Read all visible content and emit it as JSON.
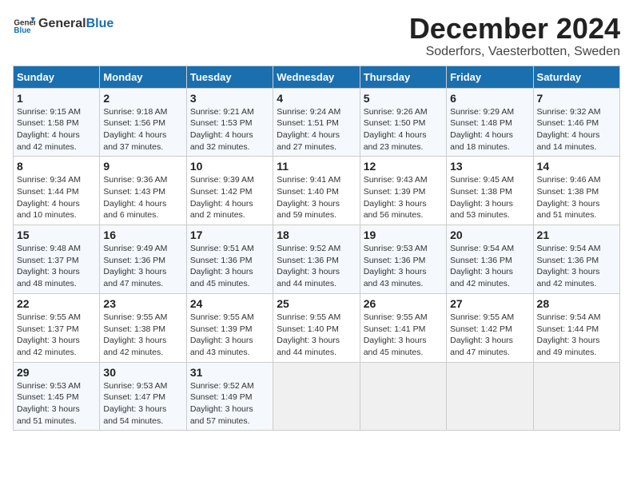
{
  "header": {
    "logo_general": "General",
    "logo_blue": "Blue",
    "title": "December 2024",
    "subtitle": "Soderfors, Vaesterbotten, Sweden"
  },
  "calendar": {
    "weekdays": [
      "Sunday",
      "Monday",
      "Tuesday",
      "Wednesday",
      "Thursday",
      "Friday",
      "Saturday"
    ],
    "weeks": [
      [
        {
          "day": "1",
          "detail": "Sunrise: 9:15 AM\nSunset: 1:58 PM\nDaylight: 4 hours\nand 42 minutes."
        },
        {
          "day": "2",
          "detail": "Sunrise: 9:18 AM\nSunset: 1:56 PM\nDaylight: 4 hours\nand 37 minutes."
        },
        {
          "day": "3",
          "detail": "Sunrise: 9:21 AM\nSunset: 1:53 PM\nDaylight: 4 hours\nand 32 minutes."
        },
        {
          "day": "4",
          "detail": "Sunrise: 9:24 AM\nSunset: 1:51 PM\nDaylight: 4 hours\nand 27 minutes."
        },
        {
          "day": "5",
          "detail": "Sunrise: 9:26 AM\nSunset: 1:50 PM\nDaylight: 4 hours\nand 23 minutes."
        },
        {
          "day": "6",
          "detail": "Sunrise: 9:29 AM\nSunset: 1:48 PM\nDaylight: 4 hours\nand 18 minutes."
        },
        {
          "day": "7",
          "detail": "Sunrise: 9:32 AM\nSunset: 1:46 PM\nDaylight: 4 hours\nand 14 minutes."
        }
      ],
      [
        {
          "day": "8",
          "detail": "Sunrise: 9:34 AM\nSunset: 1:44 PM\nDaylight: 4 hours\nand 10 minutes."
        },
        {
          "day": "9",
          "detail": "Sunrise: 9:36 AM\nSunset: 1:43 PM\nDaylight: 4 hours\nand 6 minutes."
        },
        {
          "day": "10",
          "detail": "Sunrise: 9:39 AM\nSunset: 1:42 PM\nDaylight: 4 hours\nand 2 minutes."
        },
        {
          "day": "11",
          "detail": "Sunrise: 9:41 AM\nSunset: 1:40 PM\nDaylight: 3 hours\nand 59 minutes."
        },
        {
          "day": "12",
          "detail": "Sunrise: 9:43 AM\nSunset: 1:39 PM\nDaylight: 3 hours\nand 56 minutes."
        },
        {
          "day": "13",
          "detail": "Sunrise: 9:45 AM\nSunset: 1:38 PM\nDaylight: 3 hours\nand 53 minutes."
        },
        {
          "day": "14",
          "detail": "Sunrise: 9:46 AM\nSunset: 1:38 PM\nDaylight: 3 hours\nand 51 minutes."
        }
      ],
      [
        {
          "day": "15",
          "detail": "Sunrise: 9:48 AM\nSunset: 1:37 PM\nDaylight: 3 hours\nand 48 minutes."
        },
        {
          "day": "16",
          "detail": "Sunrise: 9:49 AM\nSunset: 1:36 PM\nDaylight: 3 hours\nand 47 minutes."
        },
        {
          "day": "17",
          "detail": "Sunrise: 9:51 AM\nSunset: 1:36 PM\nDaylight: 3 hours\nand 45 minutes."
        },
        {
          "day": "18",
          "detail": "Sunrise: 9:52 AM\nSunset: 1:36 PM\nDaylight: 3 hours\nand 44 minutes."
        },
        {
          "day": "19",
          "detail": "Sunrise: 9:53 AM\nSunset: 1:36 PM\nDaylight: 3 hours\nand 43 minutes."
        },
        {
          "day": "20",
          "detail": "Sunrise: 9:54 AM\nSunset: 1:36 PM\nDaylight: 3 hours\nand 42 minutes."
        },
        {
          "day": "21",
          "detail": "Sunrise: 9:54 AM\nSunset: 1:36 PM\nDaylight: 3 hours\nand 42 minutes."
        }
      ],
      [
        {
          "day": "22",
          "detail": "Sunrise: 9:55 AM\nSunset: 1:37 PM\nDaylight: 3 hours\nand 42 minutes."
        },
        {
          "day": "23",
          "detail": "Sunrise: 9:55 AM\nSunset: 1:38 PM\nDaylight: 3 hours\nand 42 minutes."
        },
        {
          "day": "24",
          "detail": "Sunrise: 9:55 AM\nSunset: 1:39 PM\nDaylight: 3 hours\nand 43 minutes."
        },
        {
          "day": "25",
          "detail": "Sunrise: 9:55 AM\nSunset: 1:40 PM\nDaylight: 3 hours\nand 44 minutes."
        },
        {
          "day": "26",
          "detail": "Sunrise: 9:55 AM\nSunset: 1:41 PM\nDaylight: 3 hours\nand 45 minutes."
        },
        {
          "day": "27",
          "detail": "Sunrise: 9:55 AM\nSunset: 1:42 PM\nDaylight: 3 hours\nand 47 minutes."
        },
        {
          "day": "28",
          "detail": "Sunrise: 9:54 AM\nSunset: 1:44 PM\nDaylight: 3 hours\nand 49 minutes."
        }
      ],
      [
        {
          "day": "29",
          "detail": "Sunrise: 9:53 AM\nSunset: 1:45 PM\nDaylight: 3 hours\nand 51 minutes."
        },
        {
          "day": "30",
          "detail": "Sunrise: 9:53 AM\nSunset: 1:47 PM\nDaylight: 3 hours\nand 54 minutes."
        },
        {
          "day": "31",
          "detail": "Sunrise: 9:52 AM\nSunset: 1:49 PM\nDaylight: 3 hours\nand 57 minutes."
        },
        {
          "day": "",
          "detail": ""
        },
        {
          "day": "",
          "detail": ""
        },
        {
          "day": "",
          "detail": ""
        },
        {
          "day": "",
          "detail": ""
        }
      ]
    ]
  }
}
